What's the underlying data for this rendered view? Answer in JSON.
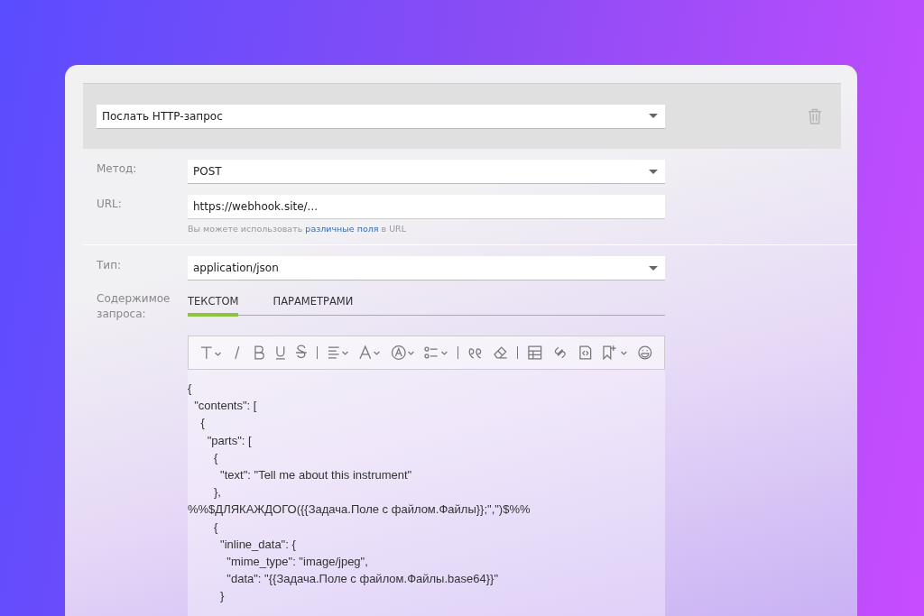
{
  "action": {
    "value": "Послать HTTP-запрос"
  },
  "fields": [
    {
      "kind": "select",
      "label": "Метод:",
      "value": "POST"
    },
    {
      "kind": "input",
      "label": "URL:",
      "value": "https://webhook.site/...",
      "hint_before": "Вы можете использовать",
      "hint_link": "различные поля",
      "hint_after": "в URL"
    },
    {
      "kind": "select",
      "label": "Тип:",
      "value": "application/json"
    }
  ],
  "body": {
    "label": "Содержимое запроса:",
    "tabs": [
      {
        "label": "ТЕКСТОМ",
        "selected": true
      },
      {
        "label": "ПАРАМЕТРАМИ",
        "selected": false
      }
    ],
    "lines": [
      "{",
      "  \"contents\": [",
      "    {",
      "      \"parts\": [",
      "        {",
      "          \"text\": \"Tell me about this instrument\"",
      "        },",
      "%%$ДЛЯКАЖДОГО({{Задача.Поле с файлом.Файлы}};\",\")$%%",
      "        {",
      "          \"inline_data\": {",
      "            \"mime_type\": \"image/jpeg\",",
      "            \"data\": \"{{Задача.Поле с файлом.Файлы.base64}}\"",
      "          }"
    ]
  }
}
